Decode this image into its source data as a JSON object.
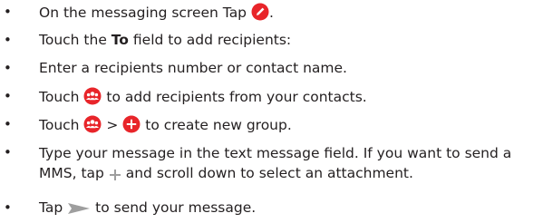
{
  "bullet_glyph": "•",
  "items": [
    {
      "before": "On the messaging screen Tap",
      "icon": "pencil-red-icon",
      "after": "."
    },
    {
      "before": "Touch the",
      "bold": "To",
      "after": "field to add recipients:"
    },
    {
      "text": "Enter a recipients number or contact name."
    },
    {
      "before": "Touch",
      "icon": "contacts-group-icon",
      "after": "to add recipients from your contacts."
    },
    {
      "before": "Touch",
      "icon": "contacts-group-icon",
      "middle": ">",
      "icon2": "add-circle-icon",
      "after": "to create new group."
    },
    {
      "line1": "Type your message in the text message field. If you want to send a",
      "line2_before": "MMS, tap",
      "icon": "plus-icon",
      "line2_after": "and scroll down to select an attachment."
    },
    {
      "before": "Tap",
      "icon": "send-arrow-icon",
      "after": "to send your message."
    }
  ],
  "colors": {
    "text": "#231f20",
    "accent_red": "#e8252a",
    "icon_blue": "#1e88e5",
    "icon_gray": "#9e9e9e"
  }
}
